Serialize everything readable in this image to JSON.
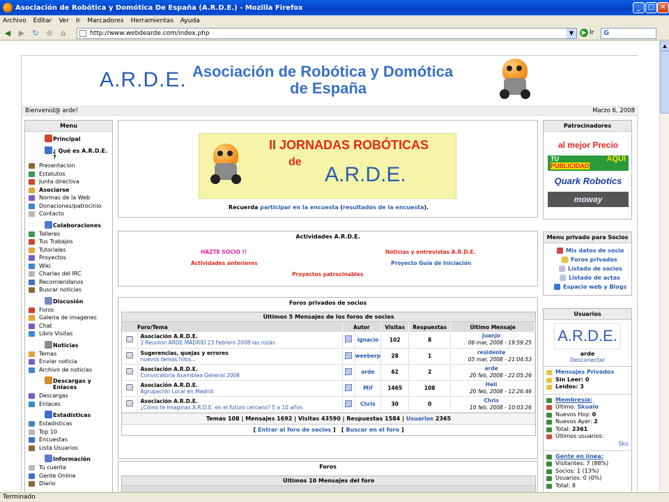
{
  "window": {
    "title": "Asociación de Robótica y Domótica De España (A.R.D.E.) - Mozilla Firefox"
  },
  "menubar": [
    "Archivo",
    "Editar",
    "Ver",
    "Ir",
    "Marcadores",
    "Herramientas",
    "Ayuda"
  ],
  "url": "http://www.webdearde.com/index.php",
  "go_label": "Ir",
  "search_letter": "G",
  "status": "Terminado",
  "banner": {
    "logo": "A.R.D.E.",
    "title_line1": "Asociación de Robótica y Domótica",
    "title_line2": "de España"
  },
  "welcome": {
    "left": "Bienvenid@ arde!",
    "date": "Marzo 6, 2008"
  },
  "menu": {
    "title": "Menu",
    "sections": [
      {
        "title": "Principal",
        "color": "#d0462a",
        "items": []
      },
      {
        "title": "¿ Qué es A.R.D.E. ?",
        "color": "#3a72c8",
        "items": [
          "Presentacion",
          "Estatutos",
          "Junta directiva",
          "Asociarse",
          "Normas de la Web",
          "Donaciones/patrocinio",
          "Contacto"
        ]
      },
      {
        "title": "Colaboraciones",
        "color": "#4a7ad8",
        "items": [
          "Talleres",
          "Tus Trabajos",
          "Tutoriales",
          "Proyectos",
          "Wiki",
          "Charlas del IRC",
          "Recomiendanos",
          "Buscar noticias"
        ]
      },
      {
        "title": "Discusión",
        "color": "#7a8ac8",
        "items": [
          "Foros",
          "Galeria de imagenes",
          "Chat",
          "Libro Visitas"
        ]
      },
      {
        "title": "Noticias",
        "color": "#8a8a8a",
        "items": [
          "Temas",
          "Enviar noticia",
          "Archivo de noticias"
        ]
      },
      {
        "title": "Descargas y Enlaces",
        "color": "#d08a2a",
        "items": [
          "Descargas",
          "Enlaces"
        ]
      },
      {
        "title": "Estadísticas",
        "color": "#3a6ad0",
        "items": [
          "Estadisticas",
          "Top 10",
          "Encuestas",
          "Lista Usuarios"
        ]
      },
      {
        "title": "Información",
        "color": "#5a7ad0",
        "items": [
          "Tu cuenta",
          "Gente Online",
          "Diario"
        ]
      }
    ]
  },
  "jornadas": {
    "line1": "II JORNADAS ROBÓTICAS",
    "line2": "de",
    "line3": "A.R.D.E."
  },
  "recuerda": {
    "a": "Recuerda",
    "b": "participar en la encuesta",
    "c": "(",
    "d": "resultados de la encuesta",
    "e": ")."
  },
  "actividades": {
    "title": "Actividades A.R.D.E.",
    "items": [
      {
        "label": "HAZTE SOCIO !!",
        "color": "#e0209a"
      },
      {
        "label": "Noticias y entrevistas A.R.D.E.",
        "color": "#e6261e"
      },
      {
        "label": "Actividades anteriores",
        "color": "#e6261e"
      },
      {
        "label": "Proyecto Guía de Iniciación",
        "color": "#2a5bb0"
      },
      {
        "label": "Proyectos patrocinables",
        "color": "#e6261e"
      }
    ]
  },
  "foros_privados": {
    "title": "Foros privados de socios",
    "caption": "Últimos 5 Mensajes de los foros de socios",
    "columns": [
      "Foro/Tema",
      "Autor",
      "Visitas",
      "Respuestas",
      "Último Mensaje"
    ],
    "rows": [
      {
        "forum": "Asociación A.R.D.E.",
        "topic": "2 Reunion ARDE MADRID 23 Febrero 2008 las rozas",
        "author": "Ignacio",
        "visits": "102",
        "replies": "8",
        "last_user": "Juanjo",
        "last_date": "06 mar, 2008 - 19:59:25"
      },
      {
        "forum": "Sugerencias, quejas y errores",
        "topic": "nuevos temas hilos...",
        "author": "weeberp",
        "visits": "28",
        "replies": "1",
        "last_user": "residente",
        "last_date": "05 mar, 2008 - 21:04:53"
      },
      {
        "forum": "Asociación A.R.D.E.",
        "topic": "Convocatoria Asamblea General 2008",
        "author": "arde",
        "visits": "62",
        "replies": "2",
        "last_user": "arde",
        "last_date": "20 feb, 2008 - 22:05:26"
      },
      {
        "forum": "Asociación A.R.D.E.",
        "topic": "Agrupación Local en Madrid",
        "author": "Mif",
        "visits": "1465",
        "replies": "108",
        "last_user": "Heli",
        "last_date": "20 feb, 2008 - 12:26:46"
      },
      {
        "forum": "Asociación A.R.D.E.",
        "topic": "¿Cómo te imaginas A.R.D.E. en el futuro cercano? 5 a 10 años",
        "author": "Chris",
        "visits": "30",
        "replies": "0",
        "last_user": "Chris",
        "last_date": "10 feb, 2008 - 10:03:26"
      }
    ],
    "stats_a": "Temas 108 | Mensajes 1692 | Visitas 43590 | Respuestas 1584 |",
    "stats_b": "Usuarios",
    "stats_c": "2365",
    "link1": "Entrar al foro de socios",
    "link2": "Buscar en el foro"
  },
  "foros": {
    "title": "Foros",
    "caption": "Últimos 10 Mensajes del foro"
  },
  "patrocinadores": {
    "title": "Patrocinadores",
    "s1": "al mejor Precio",
    "s2a": "TU",
    "s2b": "PUBLICIDAD",
    "s2c": "AQUI",
    "s3": "Quark Robotics",
    "s4": "moway"
  },
  "menu_privado": {
    "title": "Menu privado para Socios",
    "items": [
      "Mis datos de socio",
      "Foros privados",
      "Listado de socios",
      "Listado de actas",
      "Espacio web y Blogs"
    ]
  },
  "usuarios": {
    "title": "Usuarios",
    "logo": "A.R.D.E.",
    "user": "arde",
    "disconnect": "Desconectar",
    "rows1": [
      "Mensajes Privados",
      "Sin Leer: 0",
      "Leídos: 3"
    ],
    "membresia": "Membresía:",
    "rows2": [
      {
        "l": "Último:",
        "v": "Skualo"
      },
      {
        "l": "Nuevos Hoy:",
        "v": "0"
      },
      {
        "l": "Nuevos Ayer:",
        "v": "2"
      },
      {
        "l": "Total:",
        "v": "2361"
      },
      {
        "l": "Últimos usuarios:",
        "v": ""
      }
    ],
    "sku": "Sku",
    "gente": "Gente en línea:",
    "rows3": [
      "Visitantes: 7 (88%)",
      "Socios: 1 (13%)",
      "Usuarios: 0 (0%)",
      "Total: 8"
    ]
  }
}
